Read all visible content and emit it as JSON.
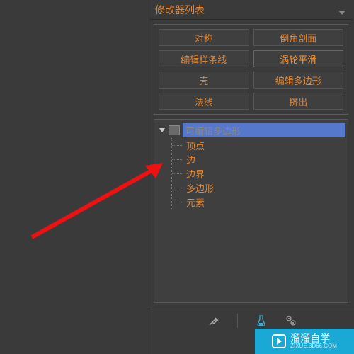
{
  "header": {
    "title": "修改器列表"
  },
  "buttons": {
    "r1c1": "对称",
    "r1c2": "倒角剖面",
    "r2c1": "编辑样条线",
    "r2c2": "涡轮平滑",
    "r3c1": "壳",
    "r3c2": "编辑多边形",
    "r4c1": "法线",
    "r4c2": "挤出"
  },
  "tree": {
    "root": "可编辑多边形",
    "items": [
      "顶点",
      "边",
      "边界",
      "多边形",
      "元素"
    ]
  },
  "watermark": {
    "label": "溜溜自学",
    "sub": "ZIXUE.3D66.COM"
  }
}
